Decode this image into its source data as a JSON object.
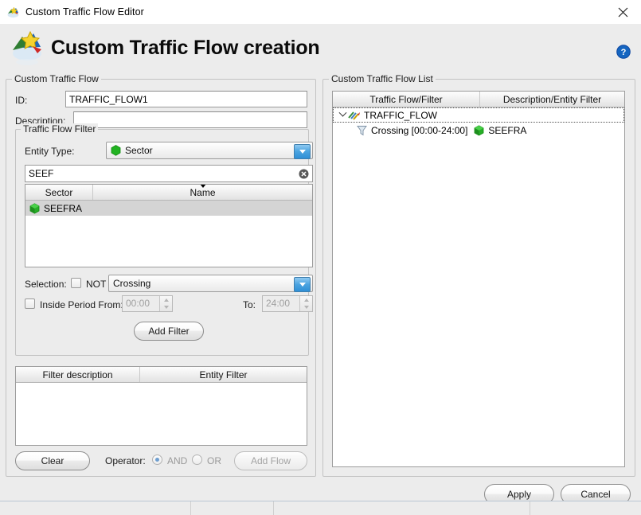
{
  "window": {
    "title": "Custom Traffic Flow Editor",
    "app_icon": "traffic-flow-icon",
    "close_icon": "close-icon"
  },
  "header": {
    "title": "Custom Traffic Flow creation",
    "icon": "traffic-flow-star-icon",
    "help_icon": "help-icon"
  },
  "left_panel": {
    "group_title": "Custom Traffic Flow",
    "id_label": "ID:",
    "id_value": "TRAFFIC_FLOW1",
    "description_label": "Description:",
    "description_value": "",
    "filter_group_title": "Traffic Flow Filter",
    "entity_type_label": "Entity Type:",
    "entity_type_value": "Sector",
    "entity_type_icon": "green-hex-icon",
    "dropdown_icon": "chevron-down-icon",
    "search_value": "SEEF",
    "clear_icon": "clear-icon",
    "entity_table": {
      "columns": [
        "Sector",
        "Name"
      ],
      "sort_column": "Name",
      "rows": [
        {
          "icon": "green-cube-icon",
          "sector": "SEEFRA",
          "name": "",
          "selected": true
        }
      ]
    },
    "selection_label": "Selection:",
    "not_label": "NOT",
    "not_checked": false,
    "selection_value": "Crossing",
    "inside_period_label": "Inside Period From:",
    "inside_period_checked": false,
    "period_from": "00:00",
    "to_label": "To:",
    "period_to": "24:00",
    "add_filter_label": "Add Filter",
    "filter_table": {
      "columns": [
        "Filter description",
        "Entity Filter"
      ],
      "rows": []
    },
    "clear_label": "Clear",
    "operator_label": "Operator:",
    "operator_and": "AND",
    "operator_or": "OR",
    "operator_selected": "AND",
    "add_flow_label": "Add Flow"
  },
  "right_panel": {
    "group_title": "Custom Traffic Flow List",
    "columns": [
      "Traffic Flow/Filter",
      "Description/Entity Filter"
    ],
    "tree": [
      {
        "expanded": true,
        "icon": "traffic-flow-node-icon",
        "label": "TRAFFIC_FLOW",
        "description": "",
        "focused": true,
        "children": [
          {
            "icon": "funnel-icon",
            "label": "Crossing [00:00-24:00]",
            "entity_icon": "green-cube-icon",
            "entity": "SEEFRA"
          }
        ]
      }
    ]
  },
  "footer": {
    "apply_label": "Apply",
    "cancel_label": "Cancel"
  },
  "colors": {
    "background": "#ececec",
    "accent_blue": "#2f8fd6",
    "entity_green": "#28b428",
    "help_blue": "#1565c0"
  }
}
